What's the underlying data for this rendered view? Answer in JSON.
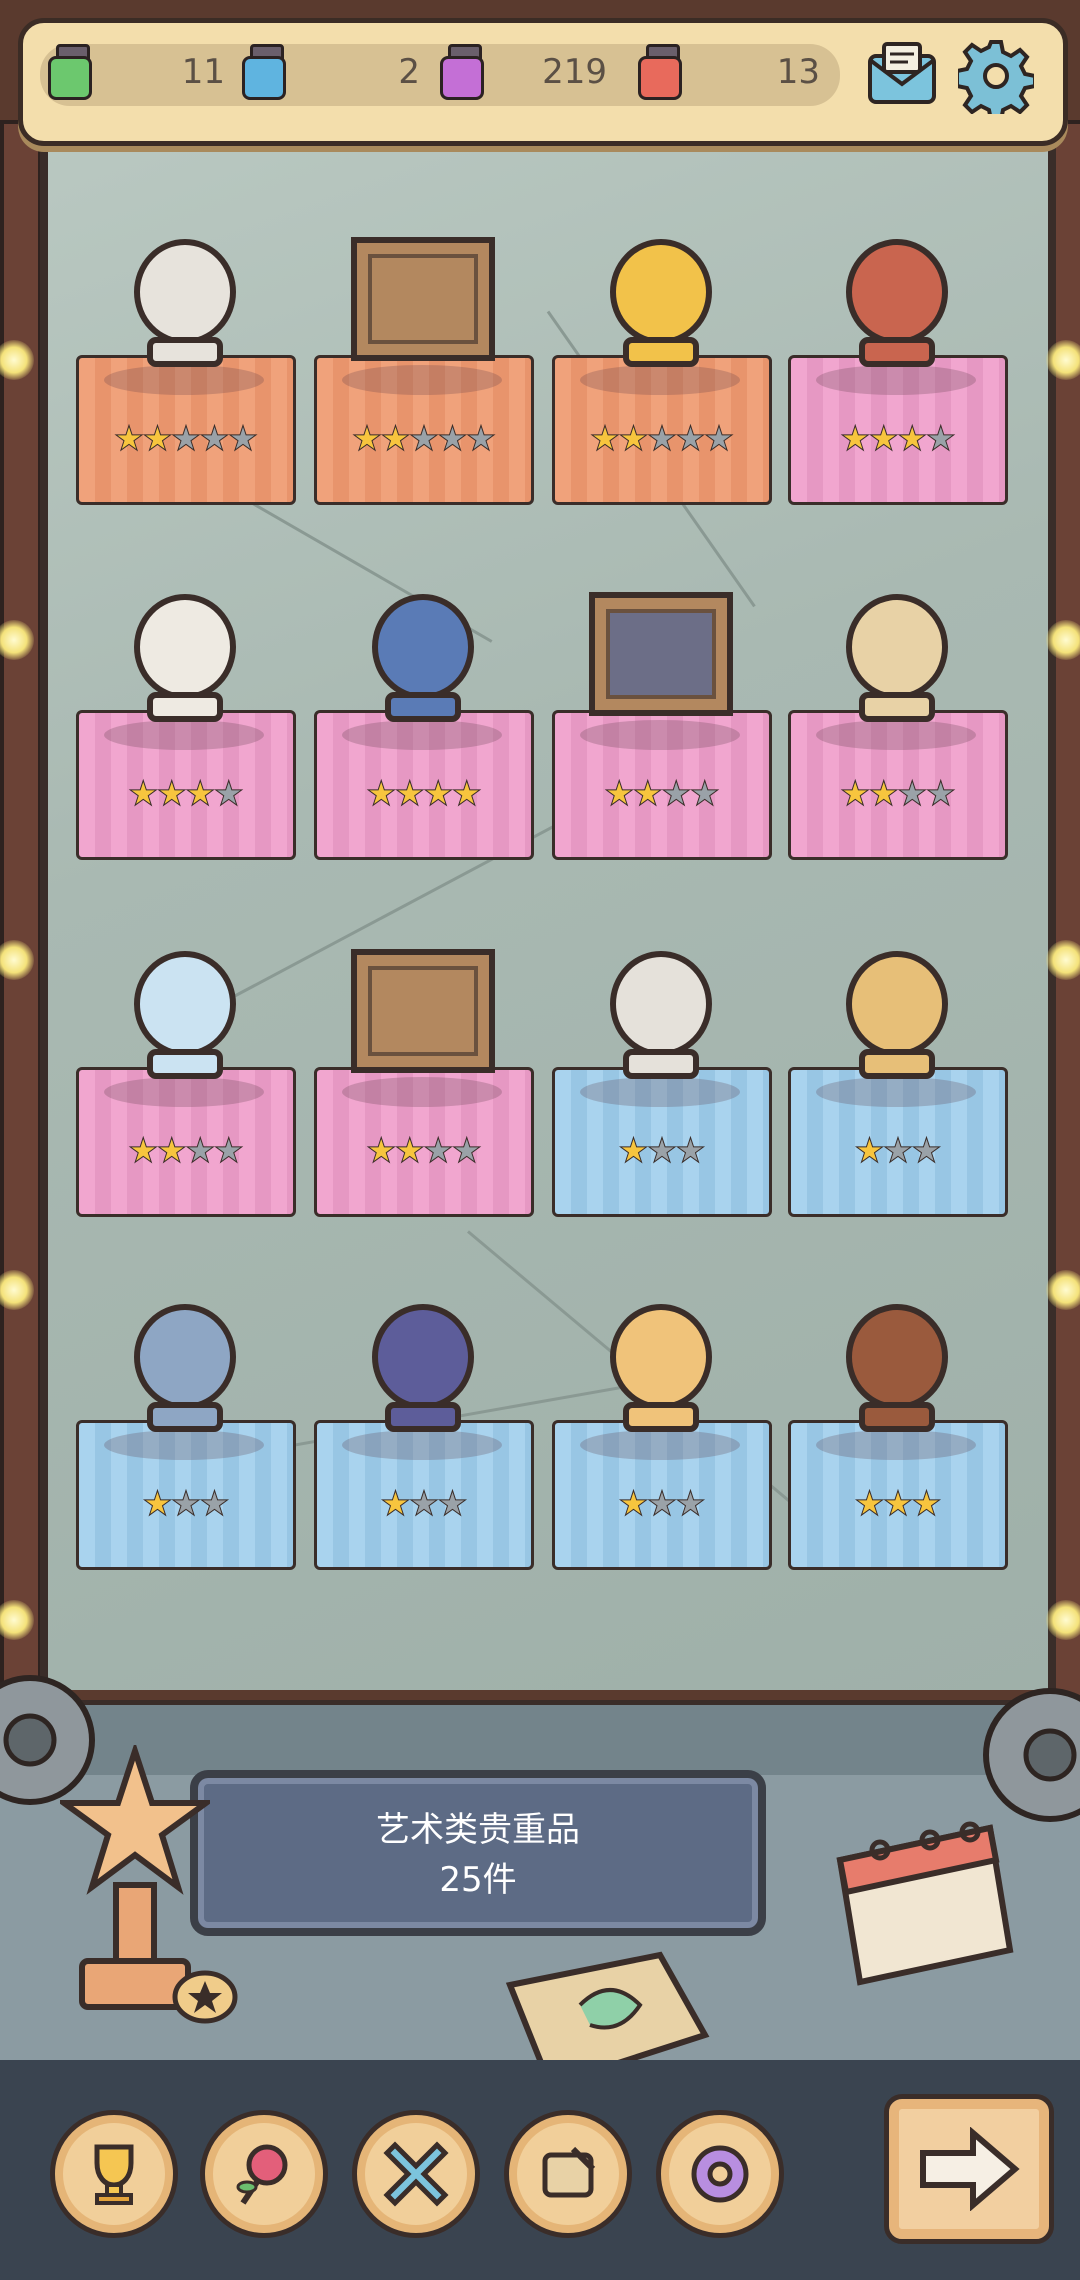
{
  "resources": [
    {
      "name": "green-potion-icon",
      "value": "11",
      "color": "#6cc86e"
    },
    {
      "name": "blue-potion-icon",
      "value": "2",
      "color": "#5fb4e0"
    },
    {
      "name": "purple-potion-icon",
      "value": "219",
      "color": "#c46fd6"
    },
    {
      "name": "red-potion-icon",
      "value": "13",
      "color": "#e86a5c"
    }
  ],
  "top_buttons": {
    "mail": "mail-icon",
    "settings": "gear-icon"
  },
  "shelves": [
    [
      {
        "item": "winged-statue",
        "cloth": "orange",
        "stars": 2,
        "max": 5
      },
      {
        "item": "framed-painting",
        "cloth": "orange",
        "stars": 2,
        "max": 5
      },
      {
        "item": "pharaoh-mask",
        "cloth": "orange",
        "stars": 2,
        "max": 5
      },
      {
        "item": "folding-screen",
        "cloth": "pink",
        "stars": 3,
        "max": 4
      }
    ],
    [
      {
        "item": "cherub-statue",
        "cloth": "pink",
        "stars": 3,
        "max": 4
      },
      {
        "item": "nefertiti-bust",
        "cloth": "pink",
        "stars": 4,
        "max": 4
      },
      {
        "item": "starry-night-painting",
        "cloth": "pink",
        "stars": 2,
        "max": 4
      },
      {
        "item": "ancient-map-scroll",
        "cloth": "pink",
        "stars": 2,
        "max": 4
      }
    ],
    [
      {
        "item": "crystal-skull",
        "cloth": "pink",
        "stars": 2,
        "max": 4
      },
      {
        "item": "framed-painting-2",
        "cloth": "pink",
        "stars": 2,
        "max": 4
      },
      {
        "item": "stone-bust",
        "cloth": "blue",
        "stars": 1,
        "max": 3
      },
      {
        "item": "coral-branch",
        "cloth": "blue",
        "stars": 1,
        "max": 3
      }
    ],
    [
      {
        "item": "parrot-clock",
        "cloth": "blue",
        "stars": 1,
        "max": 3
      },
      {
        "item": "ceramic-vase",
        "cloth": "blue",
        "stars": 1,
        "max": 3
      },
      {
        "item": "pinocchio-puppet",
        "cloth": "blue",
        "stars": 1,
        "max": 3
      },
      {
        "item": "cuckoo-house",
        "cloth": "blue",
        "stars": 3,
        "max": 3
      }
    ]
  ],
  "display_panel": {
    "line1": "艺术类贵重品",
    "line2": "25件"
  },
  "nav": [
    {
      "name": "trophy-icon"
    },
    {
      "name": "rose-icon"
    },
    {
      "name": "cross-icon"
    },
    {
      "name": "scroll-icon"
    },
    {
      "name": "gear-icon"
    }
  ],
  "next_button": "arrow-right-icon"
}
